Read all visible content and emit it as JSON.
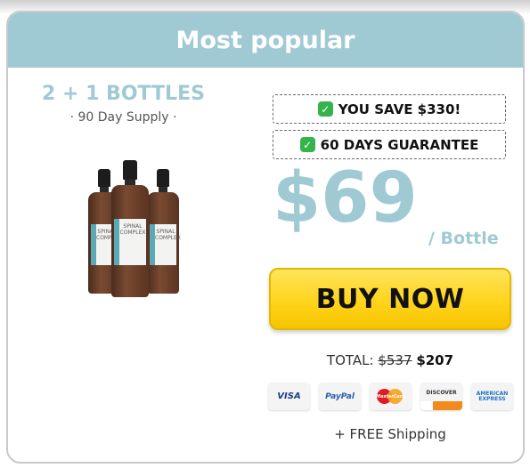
{
  "header": {
    "title": "Most popular"
  },
  "bundle": {
    "title": "2 + 1 BOTTLES",
    "subtitle": "· 90 Day Supply ·"
  },
  "product": {
    "label_line1": "SPINAL",
    "label_line2": "COMPLEX"
  },
  "badges": {
    "savings": "YOU SAVE $330!",
    "guarantee": "60 DAYS GUARANTEE",
    "icon": "check-icon"
  },
  "price": {
    "amount": "$69",
    "unit": "/ Bottle"
  },
  "buy_button": {
    "label": "BUY NOW"
  },
  "total": {
    "label": "TOTAL:",
    "old": "$537",
    "new": "$207"
  },
  "payment_methods": {
    "visa": "VISA",
    "paypal": "PayPal",
    "mastercard": "MasterCard",
    "discover": "DISCOVER",
    "amex_line1": "AMERICAN",
    "amex_line2": "EXPRESS"
  },
  "shipping": {
    "text": "+ FREE Shipping"
  },
  "colors": {
    "accent": "#9fcad4",
    "button": "#ffd41c",
    "check": "#36b34a"
  }
}
